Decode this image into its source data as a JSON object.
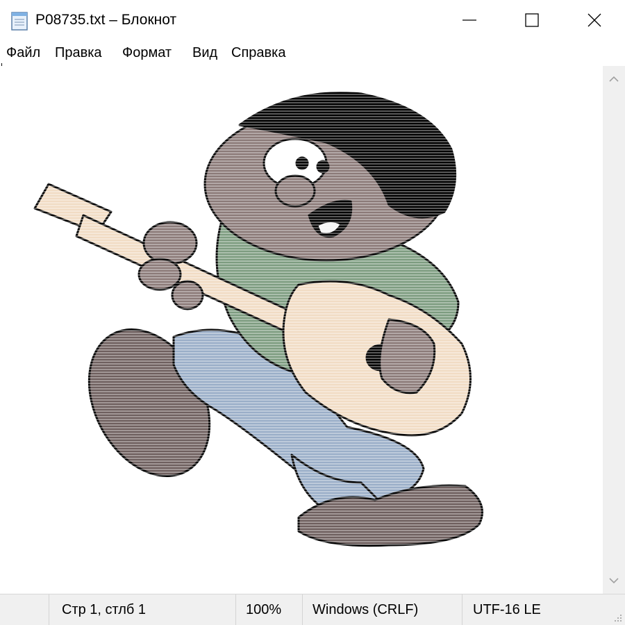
{
  "window": {
    "title": "P08735.txt – Блокнот"
  },
  "menu": {
    "items": [
      "Файл",
      "Правка",
      "Формат",
      "Вид",
      "Справка"
    ]
  },
  "status": {
    "position": "Стр 1, стлб 1",
    "zoom": "100%",
    "line_endings": "Windows (CRLF)",
    "encoding": "UTF-16 LE"
  },
  "colors": {
    "skin": "#8b7a78",
    "shirt": "#7d9c80",
    "pants": "#9aaec8",
    "guitar_body": "#f1dcc4",
    "hair": "#000000",
    "shoe": "#6e5f5e"
  }
}
